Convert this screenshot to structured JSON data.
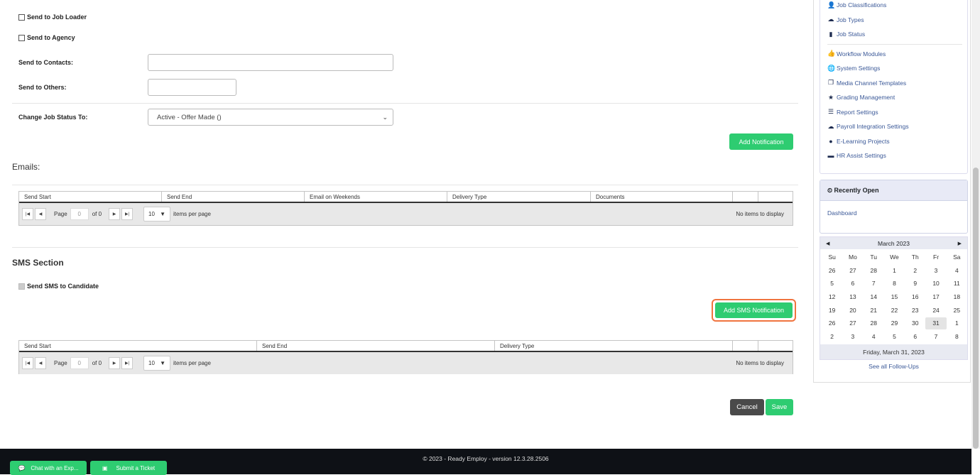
{
  "form": {
    "send_job_loader": "Send to Job Loader",
    "send_agency": "Send to Agency",
    "send_contacts_label": "Send to Contacts:",
    "send_others_label": "Send to Others:",
    "change_status_label": "Change Job Status To:",
    "status_value": "Active - Offer Made ()",
    "add_notification": "Add Notification"
  },
  "emails": {
    "title": "Emails:",
    "columns": [
      "Send Start",
      "Send End",
      "Email on Weekends",
      "Delivery Type",
      "Documents"
    ],
    "page_label": "Page",
    "page_value": "0",
    "of_label": "of 0",
    "page_size": "10",
    "per_page": "items per page",
    "no_items": "No items to display"
  },
  "sms": {
    "title": "SMS Section",
    "send_candidate": "Send SMS to Candidate",
    "add_sms": "Add SMS Notification",
    "columns": [
      "Send Start",
      "Send End",
      "Delivery Type"
    ],
    "page_label": "Page",
    "page_value": "0",
    "of_label": "of 0",
    "page_size": "10",
    "per_page": "items per page",
    "no_items": "No items to display"
  },
  "actions": {
    "cancel": "Cancel",
    "save": "Save"
  },
  "sidebar": {
    "links": [
      {
        "icon": "person-icon",
        "glyph": "👤",
        "label": "Job Classifications"
      },
      {
        "icon": "cloud-icon",
        "glyph": "☁",
        "label": "Job Types"
      },
      {
        "icon": "book-icon",
        "glyph": "▮",
        "label": "Job Status"
      },
      {
        "icon": "thumbs-up-icon",
        "glyph": "👍",
        "label": "Workflow Modules"
      },
      {
        "icon": "globe-icon",
        "glyph": "🌐",
        "label": "System Settings"
      },
      {
        "icon": "copy-icon",
        "glyph": "❐",
        "label": "Media Channel Templates"
      },
      {
        "icon": "star-icon",
        "glyph": "★",
        "label": "Grading Management"
      },
      {
        "icon": "list-icon",
        "glyph": "☰",
        "label": "Report Settings"
      },
      {
        "icon": "cloud-icon",
        "glyph": "☁",
        "label": "Payroll Integration Settings"
      },
      {
        "icon": "apple-icon",
        "glyph": "●",
        "label": "E-Learning Projects"
      },
      {
        "icon": "briefcase-icon",
        "glyph": "▬",
        "label": "HR Assist Settings"
      }
    ],
    "recent_title": "Recently Open",
    "recent_items": [
      "Dashboard"
    ]
  },
  "calendar": {
    "month": "March 2023",
    "weekdays": [
      "Su",
      "Mo",
      "Tu",
      "We",
      "Th",
      "Fr",
      "Sa"
    ],
    "weeks": [
      [
        "26",
        "27",
        "28",
        "1",
        "2",
        "3",
        "4"
      ],
      [
        "5",
        "6",
        "7",
        "8",
        "9",
        "10",
        "11"
      ],
      [
        "12",
        "13",
        "14",
        "15",
        "16",
        "17",
        "18"
      ],
      [
        "19",
        "20",
        "21",
        "22",
        "23",
        "24",
        "25"
      ],
      [
        "26",
        "27",
        "28",
        "29",
        "30",
        "31",
        "1"
      ],
      [
        "2",
        "3",
        "4",
        "5",
        "6",
        "7",
        "8"
      ]
    ],
    "selected": "31",
    "footer_date": "Friday, March 31, 2023",
    "see_all": "See all Follow-Ups"
  },
  "footer": {
    "copyright": "© 2023 - Ready Employ - version 12.3.28.2506",
    "chat": "Chat with an Exp...",
    "ticket": "Submit a Ticket"
  },
  "colors": {
    "accent_green": "#2ecc71",
    "highlight_orange": "#f0743f",
    "link": "#3b5998",
    "footer_bg": "#0e1116"
  }
}
